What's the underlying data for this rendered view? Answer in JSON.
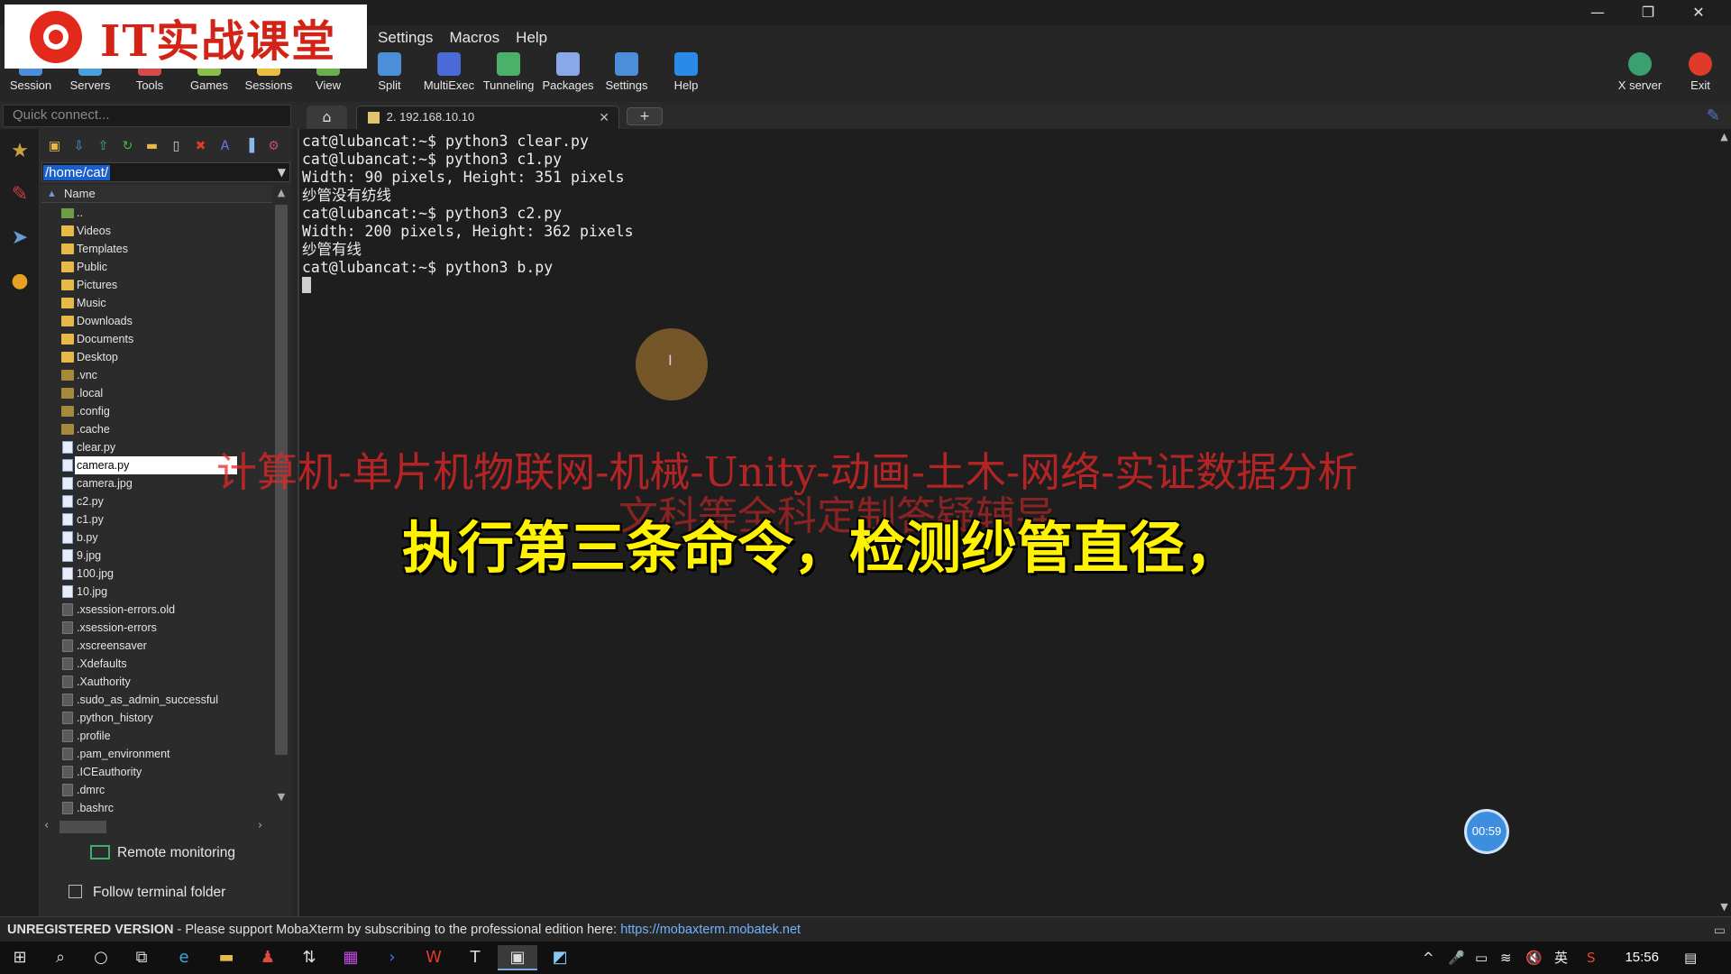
{
  "window": {
    "menu": [
      "Settings",
      "Macros",
      "Help"
    ],
    "controls": {
      "minimize": "—",
      "maximize": "❐",
      "close": "✕"
    }
  },
  "logo": {
    "text": "IT实战课堂"
  },
  "toolbar": {
    "left": [
      {
        "label": "Session",
        "color": "#4a8fd8"
      },
      {
        "label": "Servers",
        "color": "#4aa0d8"
      },
      {
        "label": "Tools",
        "color": "#d84a4a"
      },
      {
        "label": "Games",
        "color": "#8ac04a"
      },
      {
        "label": "Sessions",
        "color": "#e8c040"
      },
      {
        "label": "View",
        "color": "#6ab04a"
      },
      {
        "label": "Split",
        "color": "#4a8fd8"
      },
      {
        "label": "MultiExec",
        "color": "#4a6ad8"
      },
      {
        "label": "Tunneling",
        "color": "#4ab06a"
      },
      {
        "label": "Packages",
        "color": "#8aa8e8"
      },
      {
        "label": "Settings",
        "color": "#4a8fd8"
      },
      {
        "label": "Help",
        "color": "#2a8ae8"
      }
    ],
    "right": [
      {
        "label": "X server",
        "color": "#3aa070"
      },
      {
        "label": "Exit",
        "color": "#e03a2a"
      }
    ]
  },
  "quick_connect": {
    "placeholder": "Quick connect..."
  },
  "tabs": {
    "home_icon": "⌂",
    "active": {
      "label": "2. 192.168.10.10",
      "close": "✕"
    },
    "new_tab": "+"
  },
  "sidebar_strip": [
    {
      "icon": "star-icon",
      "glyph": "★",
      "color": "#c8a040"
    },
    {
      "icon": "tools-icon",
      "glyph": "✎",
      "color": "#c04040"
    },
    {
      "icon": "send-icon",
      "glyph": "➤",
      "color": "#6a9bd8"
    },
    {
      "icon": "sftp-icon",
      "glyph": "●",
      "color": "#e8a020"
    }
  ],
  "sftp": {
    "toolbar": [
      {
        "name": "open-folder-icon",
        "glyph": "▣",
        "color": "#e6b94a"
      },
      {
        "name": "download-icon",
        "glyph": "⇩",
        "color": "#4a9ae8"
      },
      {
        "name": "upload-icon",
        "glyph": "⇧",
        "color": "#4ab06a"
      },
      {
        "name": "refresh-icon",
        "glyph": "↻",
        "color": "#3ac040"
      },
      {
        "name": "new-folder-icon",
        "glyph": "▬",
        "color": "#e6b94a"
      },
      {
        "name": "new-file-icon",
        "glyph": "▯",
        "color": "#c8d8f0"
      },
      {
        "name": "delete-icon",
        "glyph": "✖",
        "color": "#e03a2a"
      },
      {
        "name": "rename-icon",
        "glyph": "A",
        "color": "#6a7ae8"
      },
      {
        "name": "terminal-sync-icon",
        "glyph": "▐",
        "color": "#8ab8e8"
      },
      {
        "name": "settings-icon",
        "glyph": "⚙",
        "color": "#c04a8a"
      }
    ],
    "path": "/home/cat/",
    "column_header": "Name",
    "files": [
      {
        "name": "..",
        "type": "up"
      },
      {
        "name": "Videos",
        "type": "folder"
      },
      {
        "name": "Templates",
        "type": "folder"
      },
      {
        "name": "Public",
        "type": "folder"
      },
      {
        "name": "Pictures",
        "type": "folder"
      },
      {
        "name": "Music",
        "type": "folder"
      },
      {
        "name": "Downloads",
        "type": "folder"
      },
      {
        "name": "Documents",
        "type": "folder"
      },
      {
        "name": "Desktop",
        "type": "folder"
      },
      {
        "name": ".vnc",
        "type": "folder-dim"
      },
      {
        "name": ".local",
        "type": "folder-dim"
      },
      {
        "name": ".config",
        "type": "folder-dim"
      },
      {
        "name": ".cache",
        "type": "folder-dim"
      },
      {
        "name": "clear.py",
        "type": "py"
      },
      {
        "name": "camera.py",
        "type": "py",
        "selected": true
      },
      {
        "name": "camera.jpg",
        "type": "img"
      },
      {
        "name": "c2.py",
        "type": "py"
      },
      {
        "name": "c1.py",
        "type": "py"
      },
      {
        "name": "b.py",
        "type": "py"
      },
      {
        "name": "9.jpg",
        "type": "img"
      },
      {
        "name": "100.jpg",
        "type": "img"
      },
      {
        "name": "10.jpg",
        "type": "img"
      },
      {
        "name": ".xsession-errors.old",
        "type": "doc"
      },
      {
        "name": ".xsession-errors",
        "type": "doc"
      },
      {
        "name": ".xscreensaver",
        "type": "doc"
      },
      {
        "name": ".Xdefaults",
        "type": "doc"
      },
      {
        "name": ".Xauthority",
        "type": "doc"
      },
      {
        "name": ".sudo_as_admin_successful",
        "type": "doc"
      },
      {
        "name": ".python_history",
        "type": "doc"
      },
      {
        "name": ".profile",
        "type": "doc"
      },
      {
        "name": ".pam_environment",
        "type": "doc"
      },
      {
        "name": ".ICEauthority",
        "type": "doc"
      },
      {
        "name": ".dmrc",
        "type": "doc"
      },
      {
        "name": ".bashrc",
        "type": "doc"
      }
    ],
    "remote_monitoring": "Remote monitoring",
    "follow_terminal": "Follow terminal folder"
  },
  "terminal": {
    "lines": [
      "cat@lubancat:~$ python3 clear.py",
      "cat@lubancat:~$ python3 c1.py",
      "Width: 90 pixels, Height: 351 pixels",
      "纱管没有纺线",
      "cat@lubancat:~$ python3 c2.py",
      "Width: 200 pixels, Height: 362 pixels",
      "纱管有线",
      "cat@lubancat:~$ python3 b.py"
    ]
  },
  "overlay": {
    "watermark_line1": "计算机-单片机物联网-机械-Unity-动画-土木-网络-实证数据分析",
    "watermark_line2": "文科等全科定制答疑辅导",
    "subtitle": "执行第三条命令，检测纱管直径，",
    "timer": "00:59",
    "cursor_glyph": "I"
  },
  "statusbar": {
    "unregistered": "UNREGISTERED VERSION",
    "message": "  -  Please support MobaXterm by subscribing to the professional edition here:  ",
    "link": "https://mobaxterm.mobatek.net"
  },
  "taskbar": {
    "time": "15:56",
    "ime": "英",
    "tray": [
      "^",
      "🎤",
      "▭",
      "≋",
      "🔇"
    ]
  }
}
